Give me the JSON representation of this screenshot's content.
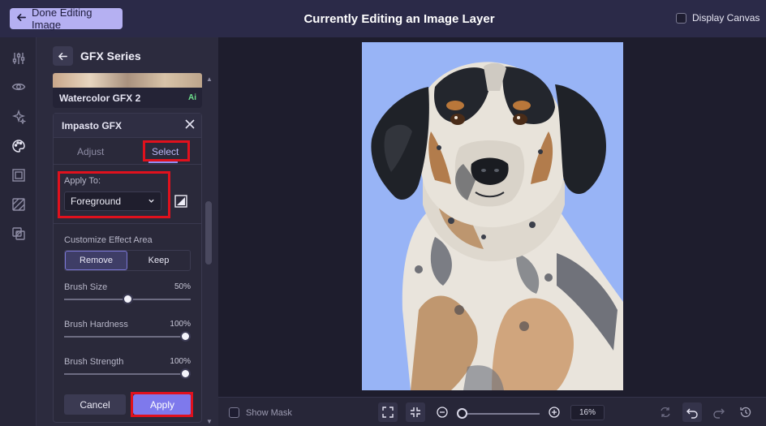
{
  "topbar": {
    "done_label": "Done Editing Image",
    "title": "Currently Editing an Image Layer",
    "display_canvas_label": "Display Canvas"
  },
  "rail": {
    "icons": [
      "adjustments-icon",
      "eye-icon",
      "sparkle-icon",
      "palette-icon",
      "frame-icon",
      "texture-icon",
      "layers-icon"
    ]
  },
  "panel": {
    "title": "GFX Series",
    "item_label": "Watercolor GFX 2",
    "item_badge": "Ai",
    "card_title": "Impasto GFX",
    "tabs": [
      "Adjust",
      "Select"
    ],
    "active_tab": "Select",
    "apply_to_label": "Apply To:",
    "apply_to_value": "Foreground",
    "customize_label": "Customize Effect Area",
    "segment": [
      "Remove",
      "Keep"
    ],
    "active_segment": "Remove",
    "sliders": [
      {
        "label": "Brush Size",
        "value": "50%",
        "level": 0.5
      },
      {
        "label": "Brush Hardness",
        "value": "100%",
        "level": 1.0
      },
      {
        "label": "Brush Strength",
        "value": "100%",
        "level": 1.0
      }
    ],
    "cancel_label": "Cancel",
    "apply_label": "Apply"
  },
  "bottombar": {
    "show_mask_label": "Show Mask",
    "zoom_value": "16%",
    "zoom_level": 0.0
  },
  "colors": {
    "accent": "#7e79ec",
    "highlight": "#e0111d",
    "image_background": "#98b4f6",
    "topbar": "#2b2a48",
    "done_button": "#b5b0f2"
  }
}
